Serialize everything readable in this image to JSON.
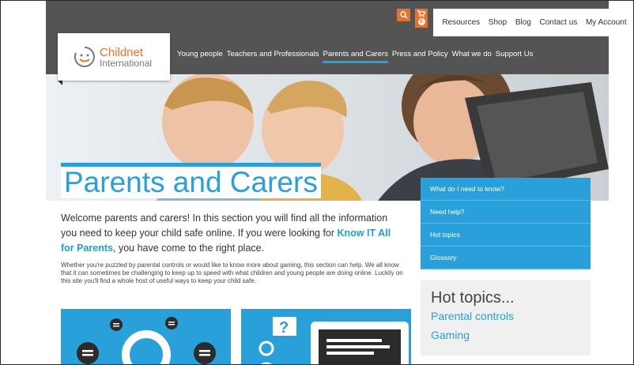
{
  "utility_nav": {
    "items": [
      "Resources",
      "Shop",
      "Blog",
      "Contact us",
      "My Account"
    ],
    "cart_count": "0"
  },
  "logo": {
    "line1": "Childnet",
    "line2": "International"
  },
  "main_nav": {
    "items": [
      "Young people",
      "Teachers and Professionals",
      "Parents and Carers",
      "Press and Policy",
      "What we do",
      "Support Us"
    ],
    "active": "Parents and Carers"
  },
  "page": {
    "title": "Parents and Carers",
    "intro_part1": "Welcome parents and carers! In this section you will find all the information you need to keep your child safe online. If you were looking for ",
    "intro_link": "Know IT All for Parents",
    "intro_part2": ", you have come to the right place.",
    "body": "Whether you're puzzled by parental controls or would like to know more about gaming, this section can help. We all know that it can sometimes be challenging to keep up to speed with what children and young people are doing online. Luckily on this site you'll find a whole host of useful ways to keep your child safe."
  },
  "side_nav": {
    "items": [
      "What do I need to know?",
      "Need help?",
      "Hot topics",
      "Glossary"
    ]
  },
  "hot_topics": {
    "title": "Hot topics...",
    "links": [
      "Parental controls",
      "Gaming"
    ]
  },
  "colors": {
    "accent_blue": "#2aa0da",
    "accent_orange": "#e8722a",
    "header_gray": "#545454"
  }
}
